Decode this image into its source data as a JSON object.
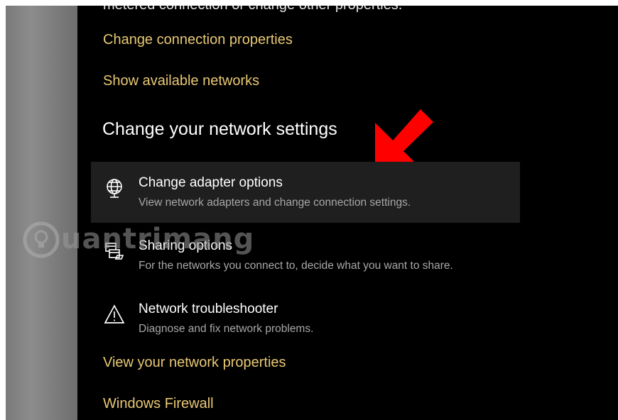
{
  "header": {
    "cut_text": "metered connection or change other properties."
  },
  "links": {
    "change_connection_properties": "Change connection properties",
    "show_available_networks": "Show available networks",
    "view_network_properties": "View your network properties",
    "windows_firewall": "Windows Firewall"
  },
  "section": {
    "title": "Change your network settings"
  },
  "options": [
    {
      "icon": "adapter-globe-icon",
      "title": "Change adapter options",
      "desc": "View network adapters and change connection settings."
    },
    {
      "icon": "sharing-icon",
      "title": "Sharing options",
      "desc": "For the networks you connect to, decide what you want to share."
    },
    {
      "icon": "warning-triangle-icon",
      "title": "Network troubleshooter",
      "desc": "Diagnose and fix network problems."
    }
  ],
  "watermark": {
    "text": "uantrimang"
  },
  "colors": {
    "background": "#000000",
    "link": "#e8c873",
    "hover": "#1f1f1f",
    "arrow": "#ff0000"
  }
}
